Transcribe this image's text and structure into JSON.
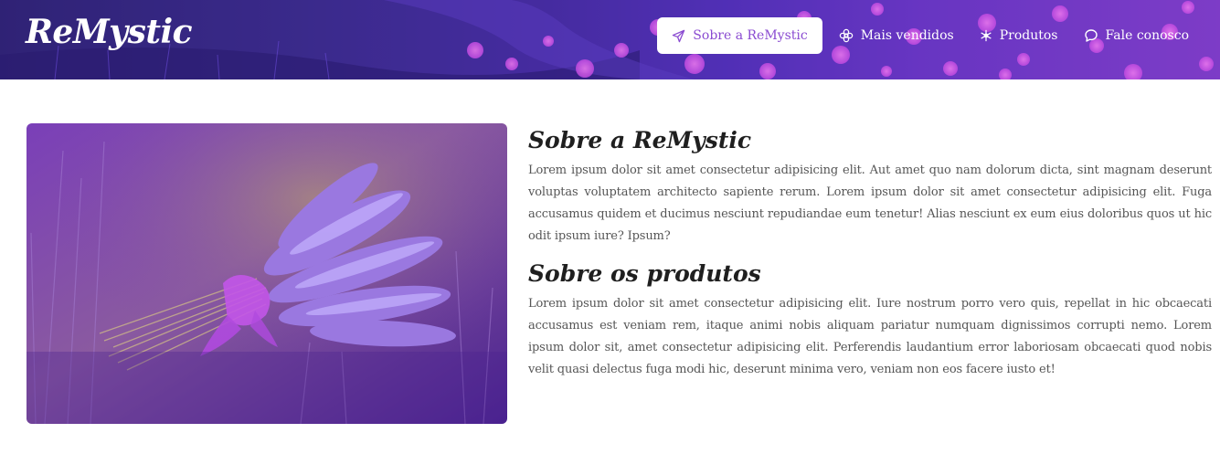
{
  "header": {
    "logo": "ReMystic",
    "nav": [
      {
        "label": "Sobre a ReMystic",
        "icon": "send-icon",
        "active": true
      },
      {
        "label": "Mais vendidos",
        "icon": "flower-icon",
        "active": false
      },
      {
        "label": "Produtos",
        "icon": "snowflake-icon",
        "active": false
      },
      {
        "label": "Fale conosco",
        "icon": "chat-bubble-icon",
        "active": false
      }
    ]
  },
  "main": {
    "section1": {
      "title": "Sobre a ReMystic",
      "body": "Lorem ipsum dolor sit amet consectetur adipisicing elit. Aut amet quo nam dolorum dicta, sint magnam deserunt voluptas voluptatem architecto sapiente rerum. Lorem ipsum dolor sit amet consectetur adipisicing elit. Fuga accusamus quidem et ducimus nesciunt repudiandae eum tenetur! Alias nesciunt ex eum eius doloribus quos ut hic odit ipsum iure? Ipsum?"
    },
    "section2": {
      "title": "Sobre os produtos",
      "body": "Lorem ipsum dolor sit amet consectetur adipisicing elit. Iure nostrum porro vero quis, repellat in hic obcaecati accusamus est veniam rem, itaque animi nobis aliquam pariatur numquam dignissimos corrupti nemo. Lorem ipsum dolor sit, amet consectetur adipisicing elit. Perferendis laudantium error laboriosam obcaecati quod nobis velit quasi delectus fuga modi hic, deserunt minima vero, veniam non eos facere iusto et!"
    }
  },
  "colors": {
    "accent": "#8a4bd1",
    "header_dark": "#2a1f6b",
    "header_light": "#9a44e0"
  }
}
